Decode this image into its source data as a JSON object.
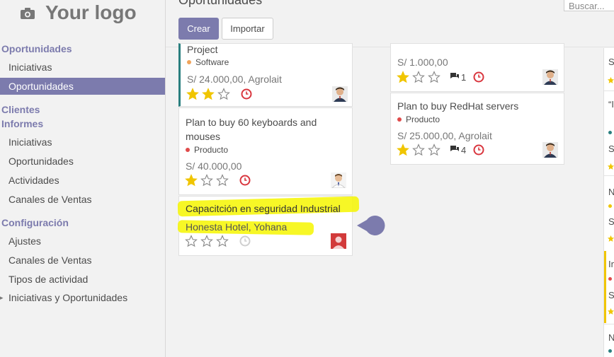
{
  "logo": {
    "text": "Your logo",
    "icon": "camera-icon"
  },
  "sidebar": {
    "sections": [
      {
        "label": "Oportunidades"
      },
      {
        "label": "Clientes"
      },
      {
        "label": "Informes"
      },
      {
        "label": "Configuración"
      }
    ],
    "items": [
      {
        "label": "Iniciativas"
      },
      {
        "label": "Oportunidades"
      },
      {
        "label": "Iniciativas"
      },
      {
        "label": "Oportunidades"
      },
      {
        "label": "Actividades"
      },
      {
        "label": "Canales de Ventas"
      },
      {
        "label": "Ajustes"
      },
      {
        "label": "Canales de Ventas"
      },
      {
        "label": "Tipos de actividad"
      },
      {
        "label": "Iniciativas y Oportunidades"
      }
    ],
    "active_index": 1
  },
  "page": {
    "title": "Oportunidades",
    "create_label": "Crear",
    "import_label": "Importar",
    "search_placeholder": "Buscar..."
  },
  "kanban": {
    "col1": [
      {
        "title": "Project",
        "tag": "Software",
        "tag_color": "#f0a45b",
        "value": "S/ 24.000,00, Agrolait",
        "stars": 2,
        "clock": "red",
        "left_bar": "#2a7f7f"
      },
      {
        "title": "Plan to buy 60 keyboards and mouses",
        "tag": "Producto",
        "tag_color": "#e04b4b",
        "value": "S/ 40.000,00",
        "stars": 1,
        "clock": "red"
      },
      {
        "title": "Capacitción en seguridad Industrial",
        "subtitle": "Honesta Hotel, Yohana",
        "stars": 0,
        "clock": "grey"
      }
    ],
    "col2": [
      {
        "value": "S/ 1.000,00",
        "stars": 1,
        "messages": "1",
        "clock": "red"
      },
      {
        "title": "Plan to buy RedHat servers",
        "tag": "Producto",
        "tag_color": "#e04b4b",
        "value": "S/ 25.000,00, Agrolait",
        "stars": 1,
        "messages": "4",
        "clock": "red"
      }
    ],
    "col3_fragments": [
      "S",
      "“I",
      "S",
      "N",
      "S",
      "In",
      "S",
      "N"
    ]
  },
  "colors": {
    "primary": "#7c7bad",
    "star": "#f0c500",
    "clock_red": "#d9363e",
    "highlight": "#f6f600"
  }
}
